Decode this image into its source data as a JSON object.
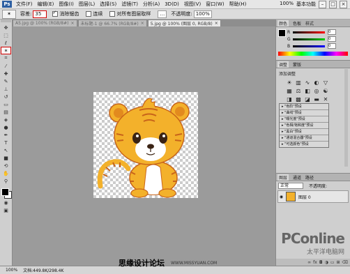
{
  "menubar": {
    "logo": "Ps",
    "items": [
      "文件(F)",
      "编辑(E)",
      "图像(I)",
      "图层(L)",
      "选择(S)",
      "滤镜(T)",
      "分析(A)",
      "3D(D)",
      "视图(V)",
      "窗口(W)",
      "帮助(H)"
    ],
    "zoom": "100%",
    "workspace": "基本功能"
  },
  "options": {
    "tolerance_label": "容差:",
    "tolerance_value": "35",
    "antialias_label": "消除锯齿",
    "contiguous_label": "连续",
    "all_layers_label": "对所有图层取样",
    "opacity_label": "不透明度:",
    "opacity_value": "100%"
  },
  "tabs": [
    {
      "label": "A5.jpg @ 100% (RGB/8#)",
      "active": false
    },
    {
      "label": "未标题-1 @ 66.7% (RGB/8#)",
      "active": false
    },
    {
      "label": "5.jpg @ 100% (图层 0, RGB/8)",
      "active": true
    }
  ],
  "panels": {
    "color_tabs": [
      "颜色",
      "色板",
      "样式"
    ],
    "color_channels": [
      {
        "label": "R",
        "value": "0"
      },
      {
        "label": "G",
        "value": "0"
      },
      {
        "label": "B",
        "value": "0"
      }
    ],
    "adjust_tabs": [
      "调整",
      "蒙版"
    ],
    "adjust_title": "添加调整",
    "presets": [
      "\"色阶\"预设",
      "\"曲线\"预设",
      "\"曝光度\"预设",
      "\"色相/饱和度\"预设",
      "\"黑白\"预设",
      "\"通道混合器\"预设",
      "\"可选颜色\"预设"
    ],
    "layers_tabs": [
      "图层",
      "通道",
      "路径"
    ],
    "blend_mode": "正常",
    "layer_opacity_label": "不透明度:",
    "fill_label": "填充:",
    "layer_name": "图层 0"
  },
  "statusbar": {
    "zoom": "100%",
    "doc_info": "文档:449.8K/298.4K"
  },
  "watermark": {
    "site_name": "思缘设计论坛",
    "url": "WWW.MISSYUAN.COM",
    "pconline": "PConline",
    "pconline_sub": "太平洋电脑网"
  },
  "colors": {
    "tiger_orange": "#f3b12b",
    "tiger_stripe": "#c8641a",
    "selection_red": "#d40000"
  }
}
